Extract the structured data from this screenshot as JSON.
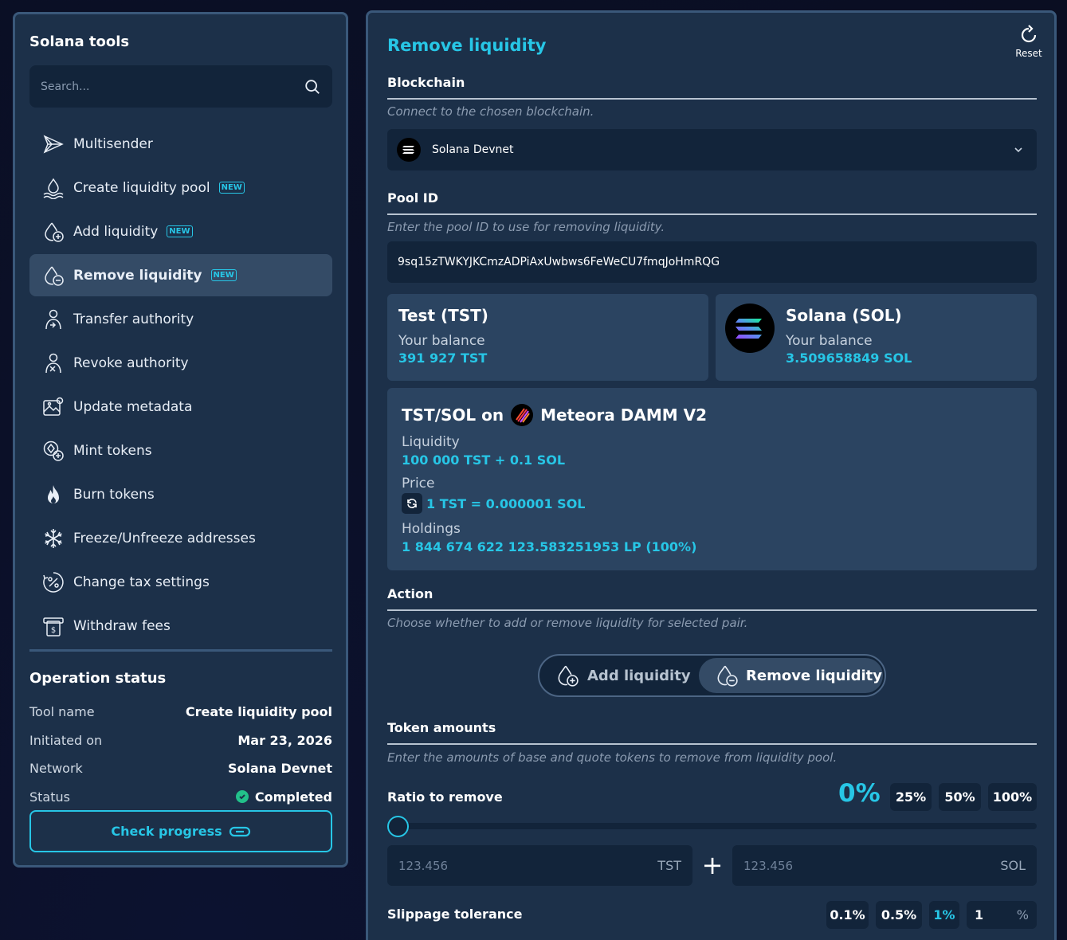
{
  "sidebar": {
    "title": "Solana tools",
    "search_placeholder": "Search...",
    "items": [
      {
        "label": "Multisender",
        "icon": "paper-plane-icon",
        "badge": ""
      },
      {
        "label": "Create liquidity pool",
        "icon": "pool-icon",
        "badge": "NEW"
      },
      {
        "label": "Add liquidity",
        "icon": "drop-plus-icon",
        "badge": "NEW"
      },
      {
        "label": "Remove liquidity",
        "icon": "drop-minus-icon",
        "badge": "NEW",
        "active": true
      },
      {
        "label": "Transfer authority",
        "icon": "user-arrow-icon",
        "badge": ""
      },
      {
        "label": "Revoke authority",
        "icon": "user-x-icon",
        "badge": ""
      },
      {
        "label": "Update metadata",
        "icon": "image-edit-icon",
        "badge": ""
      },
      {
        "label": "Mint tokens",
        "icon": "coin-plus-icon",
        "badge": ""
      },
      {
        "label": "Burn tokens",
        "icon": "flame-icon",
        "badge": ""
      },
      {
        "label": "Freeze/Unfreeze addresses",
        "icon": "snowflake-icon",
        "badge": ""
      },
      {
        "label": "Change tax settings",
        "icon": "percent-icon",
        "badge": ""
      },
      {
        "label": "Withdraw fees",
        "icon": "cash-icon",
        "badge": ""
      }
    ]
  },
  "operation": {
    "title": "Operation status",
    "rows": [
      {
        "key": "Tool name",
        "value": "Create liquidity pool"
      },
      {
        "key": "Initiated on",
        "value": "Mar 23, 2026"
      },
      {
        "key": "Network",
        "value": "Solana Devnet"
      },
      {
        "key": "Status",
        "value": "Completed"
      }
    ],
    "status_color": "#22c08a",
    "button": "Check progress"
  },
  "main": {
    "title": "Remove liquidity",
    "reset": "Reset",
    "blockchain": {
      "heading": "Blockchain",
      "desc": "Connect to the chosen blockchain.",
      "value": "Solana Devnet"
    },
    "pool": {
      "heading": "Pool ID",
      "desc": "Enter the pool ID to use for removing liquidity.",
      "value": "9sq15zTWKYJKCmzADPiAxUwbws6FeWeCU7fmqJoHmRQG"
    },
    "token_a": {
      "name": "Test (TST)",
      "balance_label": "Your balance",
      "balance": "391 927 TST"
    },
    "token_b": {
      "name": "Solana (SOL)",
      "balance_label": "Your balance",
      "balance": "3.509658849 SOL"
    },
    "pair": {
      "title_prefix": "TST/SOL on",
      "dex": "Meteora DAMM V2",
      "liquidity_label": "Liquidity",
      "liquidity": "100 000 TST + 0.1 SOL",
      "price_label": "Price",
      "price": "1 TST = 0.000001 SOL",
      "holdings_label": "Holdings",
      "holdings": "1 844 674 622 123.583251953 LP (100%)"
    },
    "action": {
      "heading": "Action",
      "desc": "Choose whether to add or remove liquidity for selected pair.",
      "add": "Add liquidity",
      "remove": "Remove liquidity"
    },
    "amounts": {
      "heading": "Token amounts",
      "desc": "Enter the amounts of base and quote tokens to remove from liquidity pool.",
      "ratio_label": "Ratio to remove",
      "ratio_value": "0%",
      "presets": [
        "25%",
        "50%",
        "100%"
      ],
      "slider_value": 0,
      "base_placeholder": "123.456",
      "base_unit": "TST",
      "plus": "+",
      "quote_placeholder": "123.456",
      "quote_unit": "SOL"
    },
    "slippage": {
      "label": "Slippage tolerance",
      "options": [
        "0.1%",
        "0.5%",
        "1%"
      ],
      "selected": "1%",
      "custom_value": "1",
      "custom_unit": "%"
    }
  },
  "colors": {
    "accent": "#27c6e6",
    "panel": "#1c3049",
    "field": "#12243a",
    "card": "#2b4461"
  }
}
